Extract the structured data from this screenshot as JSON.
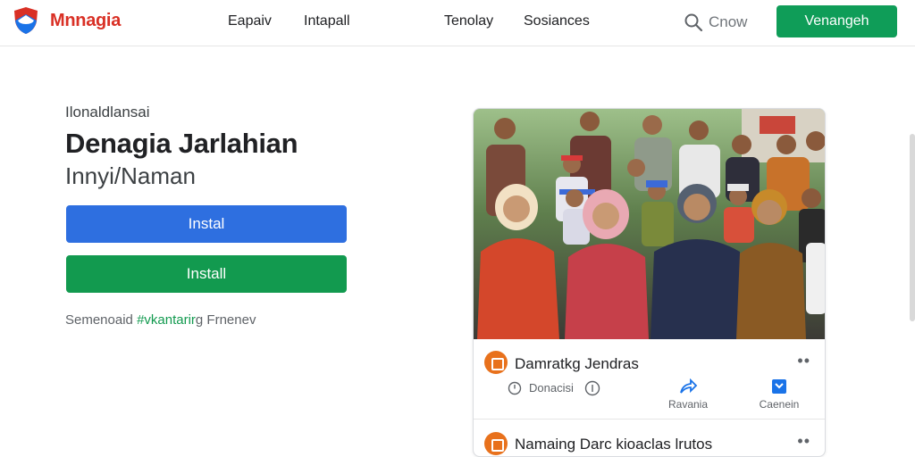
{
  "header": {
    "brand": "Mnnagia",
    "nav": [
      "Eapaiv",
      "Intapall",
      "Tenolay",
      "Sosiances"
    ],
    "search_placeholder": "Cnow",
    "cta_label": "Venangeh",
    "logo_icon": "shield-logo-icon",
    "search_icon": "search-icon"
  },
  "hero": {
    "eyebrow": "Ilonaldlansai",
    "title": "Denagia Jarlahian",
    "subtitle": "Innyi/Naman",
    "primary_button": "Instal",
    "secondary_button": "Install",
    "note_prefix": "Semenoaid ",
    "note_accent": "#vkantarir",
    "note_suffix": "g Frnenev"
  },
  "feed": {
    "post1": {
      "title": "Damratkg Jendras",
      "meta": "Donacisi",
      "actions": [
        {
          "label": "Ravania",
          "icon": "share-arrow-icon"
        },
        {
          "label": "Caenein",
          "icon": "bookmark-icon"
        }
      ]
    },
    "post2": {
      "title": "Namaing Darc kioaclas lrutos"
    }
  },
  "colors": {
    "brand": "#d93025",
    "primary_blue": "#2e6fe0",
    "primary_green": "#0f9d58",
    "post_icon": "#e8711c"
  }
}
